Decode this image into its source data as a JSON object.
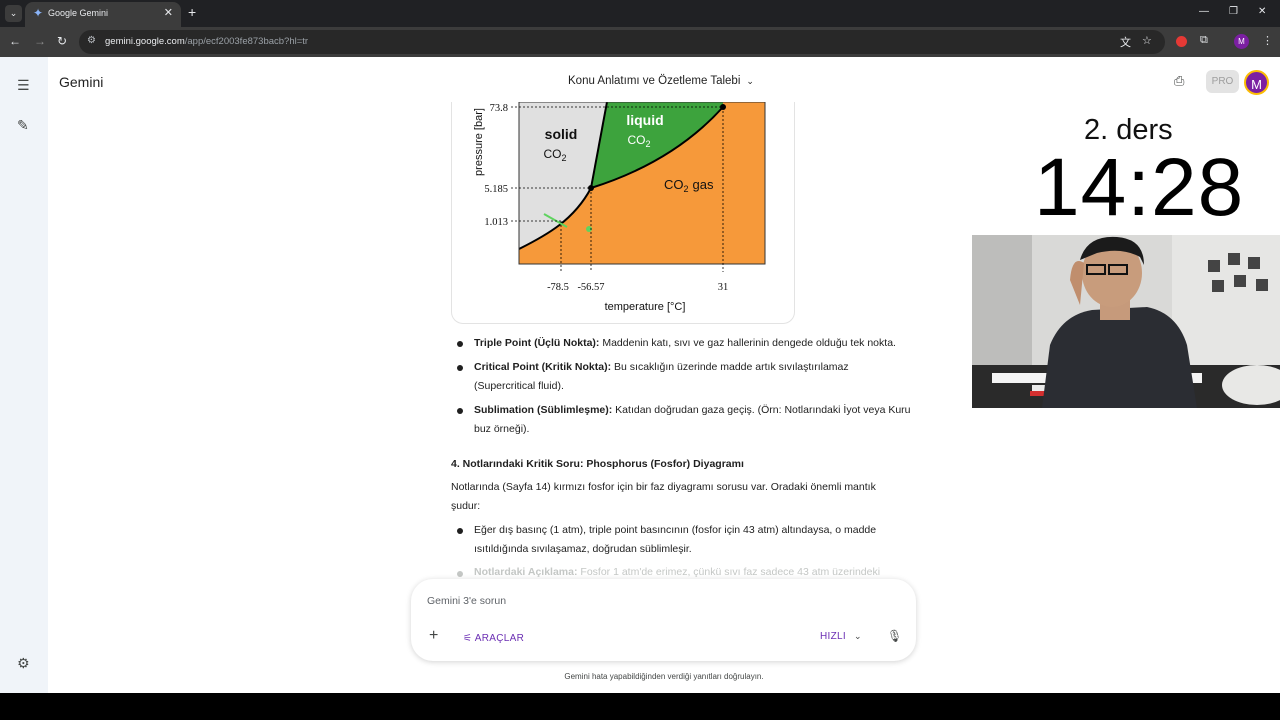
{
  "browser": {
    "tab_title": "Google Gemini",
    "url_host": "gemini.google.com",
    "url_path": "/app/ecf2003fe873bacb?hl=tr",
    "profile_initial": "M"
  },
  "app": {
    "brand": "Gemini",
    "conversation_title": "Konu Anlatımı ve Özetleme Talebi",
    "pro_label": "PRO",
    "avatar_initial": "M"
  },
  "diagram": {
    "ylabel": "pressure [bar]",
    "xlabel": "temperature [°C]",
    "y_ticks": [
      "73.8",
      "5.185",
      "1.013"
    ],
    "x_ticks": [
      "-78.5",
      "-56.57",
      "31"
    ],
    "regions": {
      "solid": "solid",
      "liquid": "liquid",
      "gas": "gas",
      "species": "CO",
      "sub": "2"
    },
    "colors": {
      "solid": "#e0e0e0",
      "liquid": "#3da33d",
      "gas": "#f6993a"
    }
  },
  "content": {
    "bullets1": [
      {
        "term": "Triple Point (Üçlü Nokta):",
        "text": " Maddenin katı, sıvı ve gaz hallerinin dengede olduğu tek nokta."
      },
      {
        "term": "Critical Point (Kritik Nokta):",
        "text": " Bu sıcaklığın üzerinde madde artık sıvılaştırılamaz (Supercritical fluid)."
      },
      {
        "term": "Sublimation (Süblimleşme):",
        "text": " Katıdan doğrudan gaza geçiş. (Örn: Notlarındaki İyot veya Kuru buz örneği)."
      }
    ],
    "section_heading": "4. Notlarındaki Kritik Soru: Phosphorus (Fosfor) Diyagramı",
    "paragraph": "Notlarında (Sayfa 14) kırmızı fosfor için bir faz diyagramı sorusu var. Oradaki önemli mantık şudur:",
    "bullets2": [
      {
        "term": "",
        "text": "Eğer dış basınç (1 atm), triple point basıncının (fosfor için 43 atm) altındaysa, o madde ısıtıldığında sıvılaşamaz, doğrudan süblimleşir."
      },
      {
        "term": "Notlardaki Açıklama:",
        "text": " Fosfor 1 atm'de erimez, çünkü sıvı faz sadece 43 atm üzerindeki"
      }
    ]
  },
  "input": {
    "placeholder": "Gemini 3'e sorun",
    "tools_label": "ARAÇLAR",
    "speed_label": "HIZLI",
    "disclaimer": "Gemini hata yapabildiğinden verdiği yanıtları doğrulayın."
  },
  "overlay": {
    "lesson": "2. ders",
    "timer": "14:28"
  }
}
